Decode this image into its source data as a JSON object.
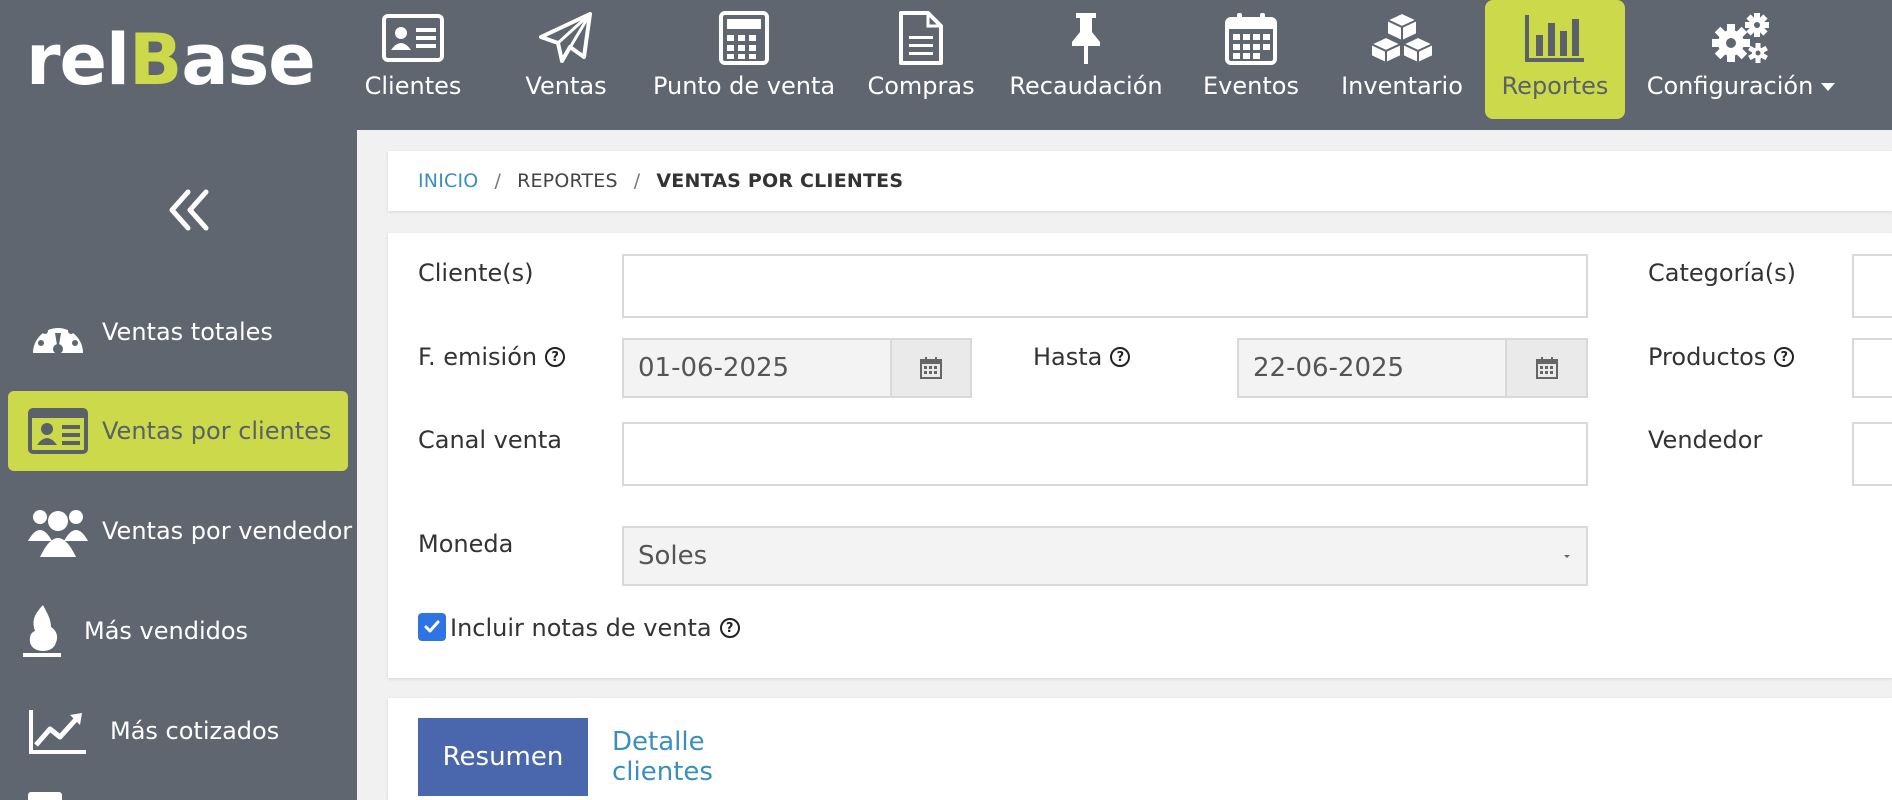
{
  "brand": {
    "name_prefix": "rel",
    "name_accent": "B",
    "name_suffix": "ase",
    "accent_color": "#cbd94a",
    "bar_color": "#5f6670"
  },
  "nav": {
    "items": [
      {
        "label": "Clientes",
        "icon": "id-card-icon"
      },
      {
        "label": "Ventas",
        "icon": "paper-plane-icon"
      },
      {
        "label": "Punto de venta",
        "icon": "calculator-icon"
      },
      {
        "label": "Compras",
        "icon": "document-icon"
      },
      {
        "label": "Recaudación",
        "icon": "pushpin-icon"
      },
      {
        "label": "Eventos",
        "icon": "calendar-icon"
      },
      {
        "label": "Inventario",
        "icon": "cubes-icon"
      },
      {
        "label": "Reportes",
        "icon": "bar-chart-icon",
        "active": true
      },
      {
        "label": "Configuración",
        "icon": "gears-icon"
      }
    ]
  },
  "sidebar": {
    "items": [
      {
        "label": "Ventas totales",
        "icon": "gauge-icon"
      },
      {
        "label": "Ventas por clientes",
        "icon": "id-card-icon",
        "active": true
      },
      {
        "label": "Ventas por vendedor",
        "icon": "users-icon"
      },
      {
        "label": "Más vendidos",
        "icon": "flame-icon"
      },
      {
        "label": "Más cotizados",
        "icon": "trend-chart-icon"
      }
    ]
  },
  "breadcrumb": {
    "home": "INICIO",
    "section": "REPORTES",
    "current": "VENTAS POR CLIENTES"
  },
  "filters": {
    "clientes": {
      "label": "Cliente(s)",
      "value": ""
    },
    "categorias": {
      "label": "Categoría(s)",
      "value": ""
    },
    "fecha_emision": {
      "label": "F. emisión",
      "value": "01-06-2025"
    },
    "hasta": {
      "label": "Hasta",
      "value": "22-06-2025"
    },
    "productos": {
      "label": "Productos",
      "value": ""
    },
    "canal_venta": {
      "label": "Canal venta",
      "value": ""
    },
    "vendedor": {
      "label": "Vendedor",
      "value": ""
    },
    "moneda": {
      "label": "Moneda",
      "value": "Soles"
    },
    "incluir_notas": {
      "label": "Incluir notas de venta",
      "checked": true
    }
  },
  "tabs": {
    "resumen": "Resumen",
    "detalle": "Detalle clientes"
  },
  "help_glyph": "?"
}
